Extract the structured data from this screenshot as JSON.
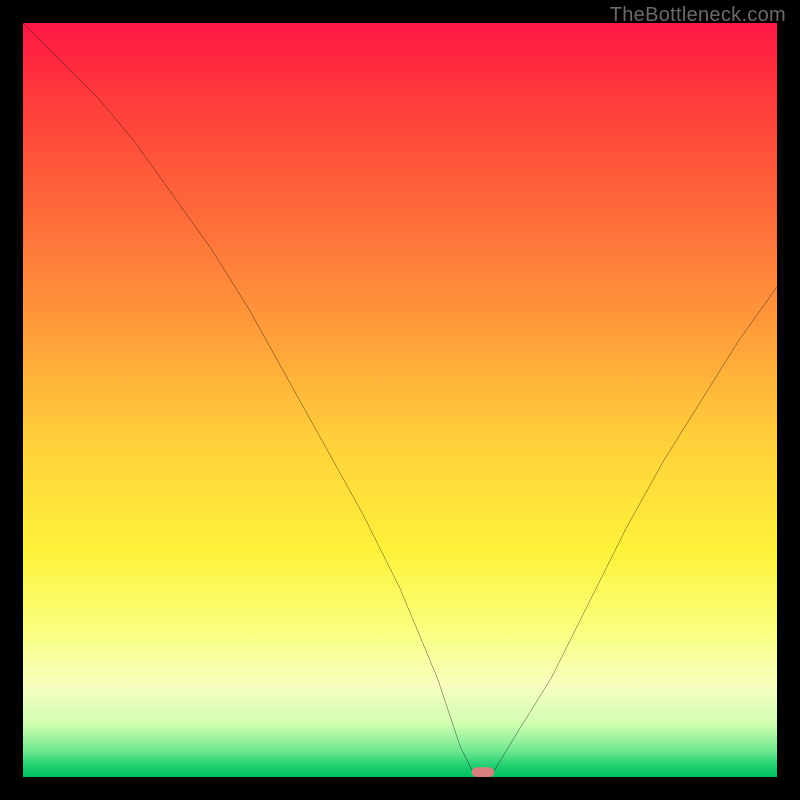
{
  "watermark": "TheBottleneck.com",
  "chart_data": {
    "type": "line",
    "title": "",
    "xlabel": "",
    "ylabel": "",
    "xlim": [
      0,
      100
    ],
    "ylim": [
      0,
      100
    ],
    "x": [
      0,
      5,
      10,
      15,
      20,
      25,
      30,
      35,
      40,
      45,
      50,
      55,
      58,
      60,
      62,
      65,
      70,
      75,
      80,
      85,
      90,
      95,
      100
    ],
    "values": [
      100,
      95,
      90,
      84,
      77,
      70,
      62,
      53,
      44,
      35,
      25,
      13,
      4,
      0,
      0,
      5,
      13,
      23,
      33,
      42,
      50,
      58,
      65
    ],
    "marker": {
      "x": 61,
      "y": 0,
      "width": 3,
      "height": 1.3,
      "color": "#d88080"
    },
    "gradient_stops": [
      {
        "offset": 0.0,
        "color": "#ff1744"
      },
      {
        "offset": 0.1,
        "color": "#ff3b3b"
      },
      {
        "offset": 0.25,
        "color": "#ff6a3a"
      },
      {
        "offset": 0.4,
        "color": "#ff9a3a"
      },
      {
        "offset": 0.55,
        "color": "#ffcf3a"
      },
      {
        "offset": 0.7,
        "color": "#fff23a"
      },
      {
        "offset": 0.8,
        "color": "#faff7a"
      },
      {
        "offset": 0.88,
        "color": "#f7ffc0"
      },
      {
        "offset": 0.93,
        "color": "#d0ffb0"
      },
      {
        "offset": 0.965,
        "color": "#70e890"
      },
      {
        "offset": 0.985,
        "color": "#20d070"
      },
      {
        "offset": 1.0,
        "color": "#00c060"
      }
    ]
  }
}
